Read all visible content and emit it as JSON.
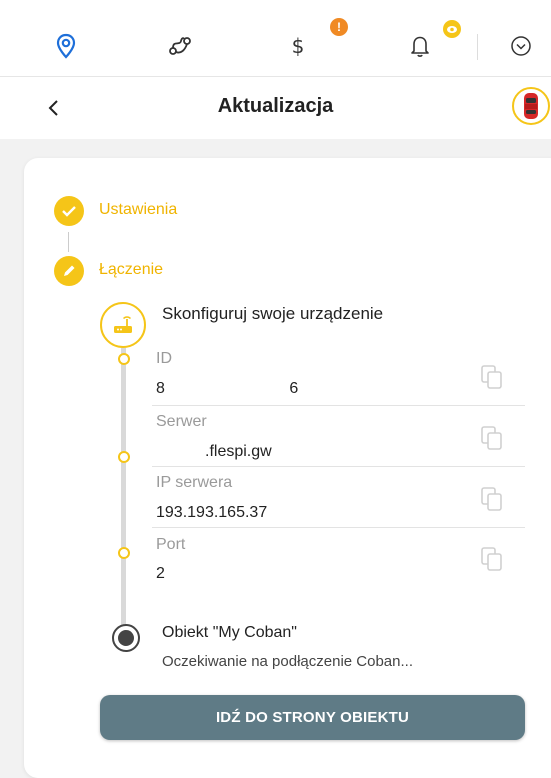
{
  "top_nav": {
    "finance_badge": "!",
    "colors": {
      "active": "#1e6fd9",
      "icon": "#333333",
      "badge_orange": "#f08a24",
      "badge_yellow": "#f5c518"
    },
    "icons": [
      "location-pin-icon",
      "route-icon",
      "dollar-icon",
      "bell-icon",
      "chevron-circle-icon"
    ]
  },
  "header": {
    "title": "Aktualizacja"
  },
  "steps": [
    {
      "label": "Ustawienia",
      "state": "done"
    },
    {
      "label": "Łączenie",
      "state": "in-progress"
    }
  ],
  "configure": {
    "title": "Skonfiguruj swoje urządzenie",
    "fields": [
      {
        "label": "ID",
        "value": "8                            6"
      },
      {
        "label": "Serwer",
        "value": ".flespi.gw"
      },
      {
        "label": "IP serwera",
        "value": "193.193.165.37"
      },
      {
        "label": "Port",
        "value": "2"
      }
    ]
  },
  "object": {
    "title": "Obiekt \"My Coban\"",
    "status": "Oczekiwanie na podłączenie Coban..."
  },
  "cta": {
    "label": "IDŹ DO STRONY OBIEKTU",
    "color": "#5f7b86"
  },
  "accent_color": "#f5c518"
}
